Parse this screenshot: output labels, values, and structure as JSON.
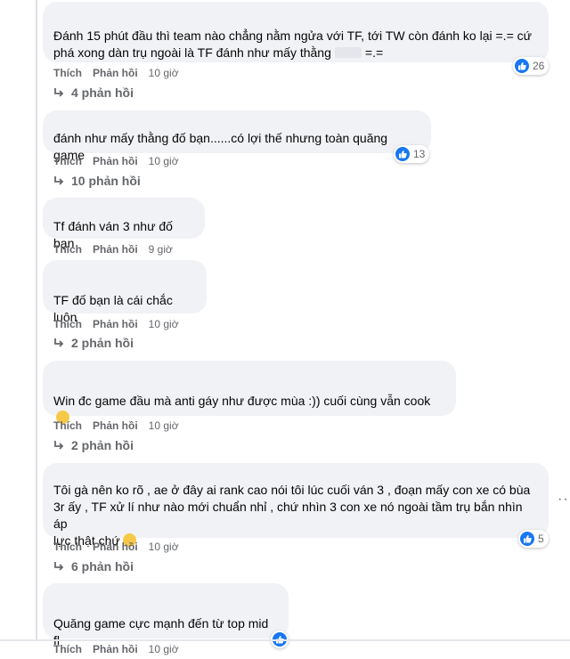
{
  "action_labels": {
    "like": "Thích",
    "reply": "Phản hồi"
  },
  "comments": [
    {
      "text_line1": "Đánh 15 phút đầu thì team nào chẳng nằm ngửa với TF, tới TW còn đánh ko lại =.= cứ",
      "text_line2_a": "phá xong dàn trụ ngoài là TF đánh như mấy thằng",
      "text_line2_b": "=.=",
      "time": "10 giờ",
      "reactions": "26",
      "replies": "4 phản hồi"
    },
    {
      "text": "đánh như mấy thằng đố bạn......có lợi thế nhưng toàn quăng game",
      "time": "10 giờ",
      "reactions": "13",
      "replies": "10 phản hồi"
    },
    {
      "text": "Tf đánh ván 3 như đố bạn",
      "time": "9 giờ"
    },
    {
      "text": "TF đố bạn là cái chắc luôn",
      "time": "10 giờ",
      "replies": "2 phản hồi"
    },
    {
      "text": "Win đc game đầu mà anti gáy như được mùa :)) cuối cùng vẫn cook",
      "emoji": "grinning-sweat",
      "time": "10 giờ",
      "replies": "2 phản hồi"
    },
    {
      "text_line1": "Tôi gà nên ko rõ , ae ở đây ai rank cao nói tôi lúc cuối ván 3 , đoạn mấy con xe có bùa",
      "text_line2": "3r ấy , TF xử lí như nào mới chuẩn nhỉ , chứ nhìn 3 con xe nó ngoài tầm trụ bắn nhìn áp",
      "text_line3": "lực thật chứ",
      "emoji": "grinning-sweat",
      "time": "10 giờ",
      "reactions": "5",
      "replies": "6 phản hồi"
    },
    {
      "text": "Quăng game cực mạnh đến từ top mid fl",
      "time": "10 giờ"
    }
  ],
  "icons": {
    "reaction": "like-icon",
    "reply_arrow": "reply-arrow-icon",
    "more": "more-options-icon"
  },
  "colors": {
    "like_blue": "#1877f2",
    "bubble_bg": "#f0f2f5",
    "meta_text": "#65676b"
  }
}
